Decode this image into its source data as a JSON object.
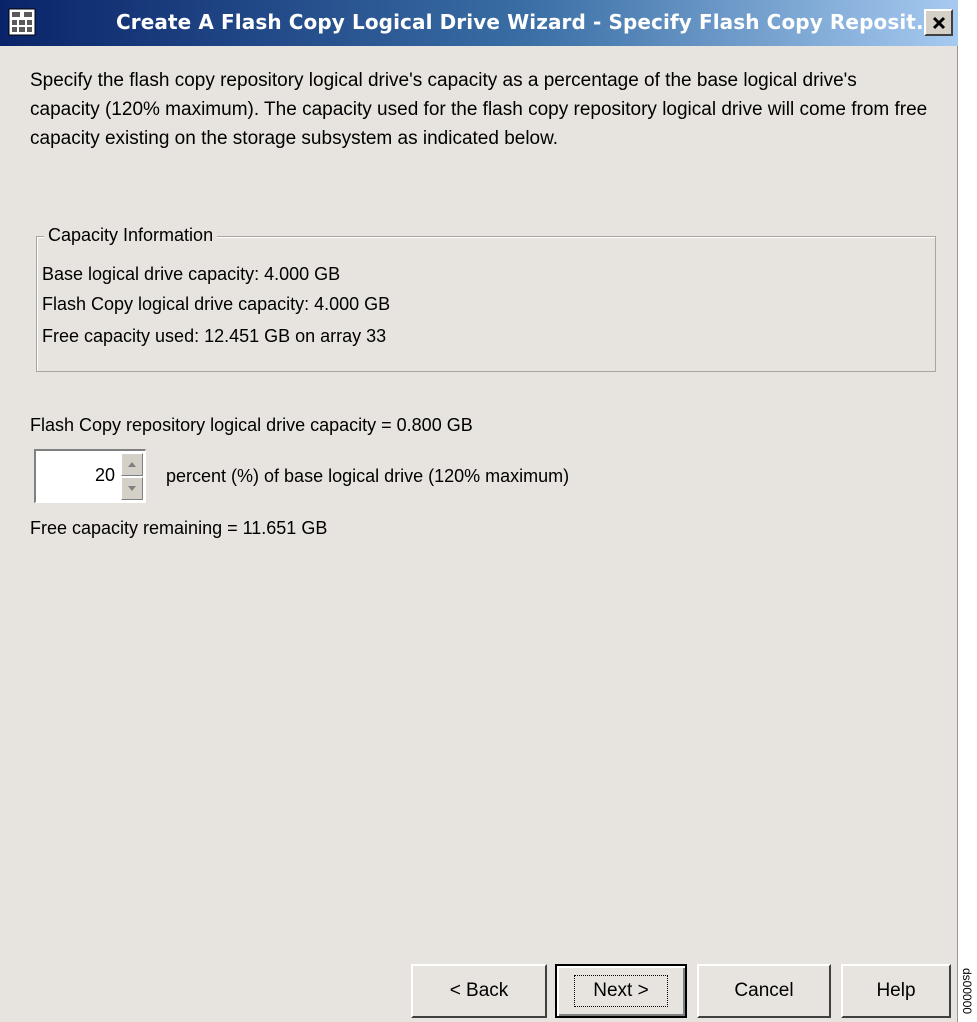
{
  "window": {
    "title": "Create A Flash Copy Logical Drive Wizard - Specify Flash Copy Reposit..."
  },
  "instructions": "Specify the flash copy repository logical drive's capacity as a percentage of the base logical drive's capacity (120% maximum). The capacity used for the flash copy repository logical drive will come from free capacity existing on the storage subsystem as indicated below.",
  "capacity_info": {
    "legend": "Capacity Information",
    "lines": [
      "Base logical drive capacity: 4.000 GB",
      "Flash Copy logical drive capacity: 4.000 GB",
      "Free capacity used: 12.451 GB on array 33"
    ]
  },
  "repository": {
    "capacity_text": "Flash Copy repository logical drive capacity = 0.800 GB",
    "percent_value": "20",
    "percent_label": "percent (%) of base logical drive (120% maximum)",
    "free_remaining": "Free capacity remaining = 11.651 GB"
  },
  "buttons": {
    "back": "< Back",
    "next": "Next >",
    "cancel": "Cancel",
    "help": "Help"
  },
  "side_id": "ds00000"
}
